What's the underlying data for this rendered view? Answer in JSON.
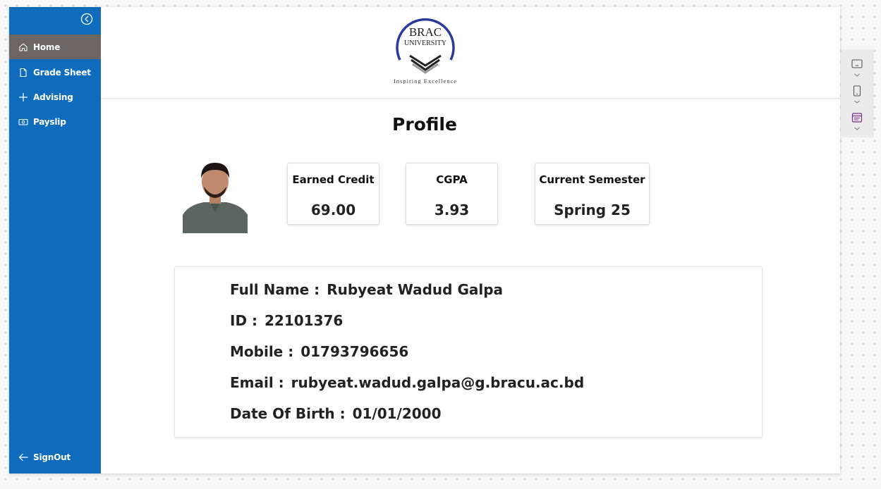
{
  "sidebar": {
    "items": [
      {
        "label": "Home",
        "icon": "home-icon",
        "active": true
      },
      {
        "label": "Grade Sheet",
        "icon": "document-icon",
        "active": false
      },
      {
        "label": "Advising",
        "icon": "plus-icon",
        "active": false
      },
      {
        "label": "Payslip",
        "icon": "money-icon",
        "active": false
      }
    ],
    "signout_label": "SignOut"
  },
  "header": {
    "logo": {
      "line1": "BRAC",
      "line2": "UNIVERSITY",
      "tagline": "Inspiring Excellence"
    }
  },
  "profile": {
    "title": "Profile",
    "stats": [
      {
        "label": "Earned Credit",
        "value": "69.00"
      },
      {
        "label": "CGPA",
        "value": "3.93"
      },
      {
        "label": "Current Semester",
        "value": "Spring 25"
      }
    ],
    "details": [
      {
        "label": "Full Name :",
        "value": "Rubyeat Wadud Galpa"
      },
      {
        "label": "ID :",
        "value": "22101376"
      },
      {
        "label": "Mobile :",
        "value": "01793796656"
      },
      {
        "label": "Email :",
        "value": "rubyeat.wadud.galpa@g.bracu.ac.bd"
      },
      {
        "label": "Date Of Birth :",
        "value": "01/01/2000"
      }
    ]
  },
  "colors": {
    "sidebar_bg": "#0f6cbd",
    "sidebar_active": "#6b6661",
    "logo_blue": "#2b3a9e"
  }
}
